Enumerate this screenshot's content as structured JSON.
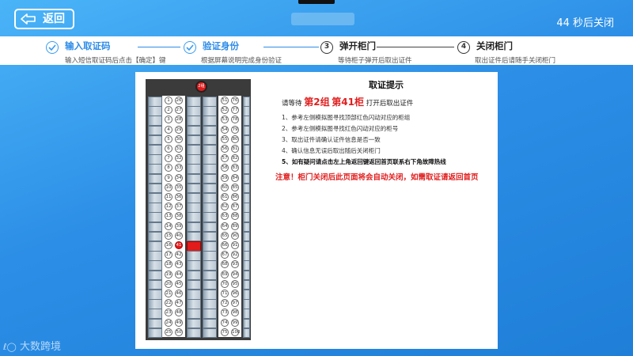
{
  "header": {
    "back_label": "返回",
    "countdown": "44 秒后关闭"
  },
  "steps": [
    {
      "num": "",
      "title": "输入取证码",
      "sub": "输入短信取证码后点击【确定】键",
      "status": "done"
    },
    {
      "num": "",
      "title": "验证身份",
      "sub": "根据屏幕说明完成身份验证",
      "status": "done"
    },
    {
      "num": "3",
      "title": "弹开柜门",
      "sub": "等待柜子弹开后取出证件",
      "status": "current"
    },
    {
      "num": "4",
      "title": "关闭柜门",
      "sub": "取出证件后请随手关闭柜门",
      "status": "todo"
    }
  ],
  "cabinet": {
    "top_lamp": "2组",
    "left_numbers": [
      "1",
      "2",
      "3",
      "4",
      "5",
      "6",
      "7",
      "8",
      "9",
      "10",
      "11",
      "12",
      "13",
      "14",
      "15",
      "16",
      "17",
      "18",
      "19",
      "20",
      "21",
      "22",
      "23",
      "24",
      "25"
    ],
    "left_numbers_2": [
      "26",
      "27",
      "28",
      "29",
      "30",
      "31",
      "32",
      "33",
      "34",
      "35",
      "36",
      "37",
      "38",
      "39",
      "40",
      "41",
      "42",
      "43",
      "44",
      "45",
      "46",
      "47",
      "48",
      "49",
      "50"
    ],
    "right_numbers": [
      "51",
      "52",
      "53",
      "54",
      "55",
      "56",
      "57",
      "58",
      "59",
      "60",
      "61",
      "62",
      "63",
      "64",
      "65",
      "66",
      "67",
      "68",
      "69",
      "70",
      "71",
      "72",
      "73",
      "74",
      "75"
    ],
    "right_numbers_2": [
      "76",
      "77",
      "78",
      "79",
      "80",
      "81",
      "82",
      "83",
      "84",
      "85",
      "86",
      "87",
      "88",
      "89",
      "90",
      "91",
      "92",
      "93",
      "94",
      "95",
      "96",
      "97",
      "98",
      "99",
      "100"
    ],
    "highlight": "41",
    "colors": {
      "highlight": "#e21b1b",
      "frame": "#3b3b3b"
    }
  },
  "hint": {
    "title": "取证提示",
    "wait_prefix": "请等待",
    "group": "第2组",
    "cabinet": "第41柜",
    "wait_suffix": "打开后取出证件",
    "items": [
      "1、参考左侧模拟图寻找顶部红色闪动对应的柜组",
      "2、参考左侧模拟图寻找红色闪动对应的柜号",
      "3、取出证件请确认证件信息是否一致",
      "4、确认信息无误后取出随后关闭柜门",
      "5、如有疑问请点击左上角返回键返回首页联系右下角故障热线"
    ],
    "warning": "注意！柜门关闭后此页面将会自动关闭，如需取证请返回首页"
  },
  "footer": {
    "logo": "大数跨境"
  }
}
